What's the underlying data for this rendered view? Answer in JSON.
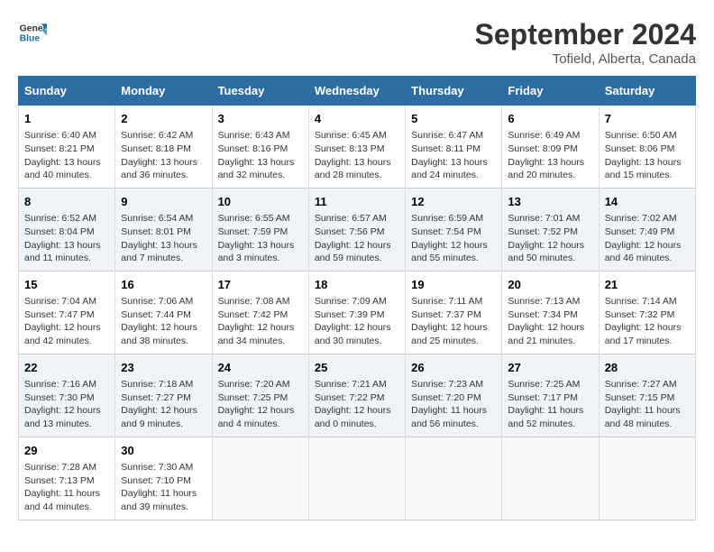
{
  "header": {
    "logo_line1": "General",
    "logo_line2": "Blue",
    "month": "September 2024",
    "location": "Tofield, Alberta, Canada"
  },
  "weekdays": [
    "Sunday",
    "Monday",
    "Tuesday",
    "Wednesday",
    "Thursday",
    "Friday",
    "Saturday"
  ],
  "weeks": [
    [
      {
        "day": "1",
        "info": "Sunrise: 6:40 AM\nSunset: 8:21 PM\nDaylight: 13 hours\nand 40 minutes."
      },
      {
        "day": "2",
        "info": "Sunrise: 6:42 AM\nSunset: 8:18 PM\nDaylight: 13 hours\nand 36 minutes."
      },
      {
        "day": "3",
        "info": "Sunrise: 6:43 AM\nSunset: 8:16 PM\nDaylight: 13 hours\nand 32 minutes."
      },
      {
        "day": "4",
        "info": "Sunrise: 6:45 AM\nSunset: 8:13 PM\nDaylight: 13 hours\nand 28 minutes."
      },
      {
        "day": "5",
        "info": "Sunrise: 6:47 AM\nSunset: 8:11 PM\nDaylight: 13 hours\nand 24 minutes."
      },
      {
        "day": "6",
        "info": "Sunrise: 6:49 AM\nSunset: 8:09 PM\nDaylight: 13 hours\nand 20 minutes."
      },
      {
        "day": "7",
        "info": "Sunrise: 6:50 AM\nSunset: 8:06 PM\nDaylight: 13 hours\nand 15 minutes."
      }
    ],
    [
      {
        "day": "8",
        "info": "Sunrise: 6:52 AM\nSunset: 8:04 PM\nDaylight: 13 hours\nand 11 minutes."
      },
      {
        "day": "9",
        "info": "Sunrise: 6:54 AM\nSunset: 8:01 PM\nDaylight: 13 hours\nand 7 minutes."
      },
      {
        "day": "10",
        "info": "Sunrise: 6:55 AM\nSunset: 7:59 PM\nDaylight: 13 hours\nand 3 minutes."
      },
      {
        "day": "11",
        "info": "Sunrise: 6:57 AM\nSunset: 7:56 PM\nDaylight: 12 hours\nand 59 minutes."
      },
      {
        "day": "12",
        "info": "Sunrise: 6:59 AM\nSunset: 7:54 PM\nDaylight: 12 hours\nand 55 minutes."
      },
      {
        "day": "13",
        "info": "Sunrise: 7:01 AM\nSunset: 7:52 PM\nDaylight: 12 hours\nand 50 minutes."
      },
      {
        "day": "14",
        "info": "Sunrise: 7:02 AM\nSunset: 7:49 PM\nDaylight: 12 hours\nand 46 minutes."
      }
    ],
    [
      {
        "day": "15",
        "info": "Sunrise: 7:04 AM\nSunset: 7:47 PM\nDaylight: 12 hours\nand 42 minutes."
      },
      {
        "day": "16",
        "info": "Sunrise: 7:06 AM\nSunset: 7:44 PM\nDaylight: 12 hours\nand 38 minutes."
      },
      {
        "day": "17",
        "info": "Sunrise: 7:08 AM\nSunset: 7:42 PM\nDaylight: 12 hours\nand 34 minutes."
      },
      {
        "day": "18",
        "info": "Sunrise: 7:09 AM\nSunset: 7:39 PM\nDaylight: 12 hours\nand 30 minutes."
      },
      {
        "day": "19",
        "info": "Sunrise: 7:11 AM\nSunset: 7:37 PM\nDaylight: 12 hours\nand 25 minutes."
      },
      {
        "day": "20",
        "info": "Sunrise: 7:13 AM\nSunset: 7:34 PM\nDaylight: 12 hours\nand 21 minutes."
      },
      {
        "day": "21",
        "info": "Sunrise: 7:14 AM\nSunset: 7:32 PM\nDaylight: 12 hours\nand 17 minutes."
      }
    ],
    [
      {
        "day": "22",
        "info": "Sunrise: 7:16 AM\nSunset: 7:30 PM\nDaylight: 12 hours\nand 13 minutes."
      },
      {
        "day": "23",
        "info": "Sunrise: 7:18 AM\nSunset: 7:27 PM\nDaylight: 12 hours\nand 9 minutes."
      },
      {
        "day": "24",
        "info": "Sunrise: 7:20 AM\nSunset: 7:25 PM\nDaylight: 12 hours\nand 4 minutes."
      },
      {
        "day": "25",
        "info": "Sunrise: 7:21 AM\nSunset: 7:22 PM\nDaylight: 12 hours\nand 0 minutes."
      },
      {
        "day": "26",
        "info": "Sunrise: 7:23 AM\nSunset: 7:20 PM\nDaylight: 11 hours\nand 56 minutes."
      },
      {
        "day": "27",
        "info": "Sunrise: 7:25 AM\nSunset: 7:17 PM\nDaylight: 11 hours\nand 52 minutes."
      },
      {
        "day": "28",
        "info": "Sunrise: 7:27 AM\nSunset: 7:15 PM\nDaylight: 11 hours\nand 48 minutes."
      }
    ],
    [
      {
        "day": "29",
        "info": "Sunrise: 7:28 AM\nSunset: 7:13 PM\nDaylight: 11 hours\nand 44 minutes."
      },
      {
        "day": "30",
        "info": "Sunrise: 7:30 AM\nSunset: 7:10 PM\nDaylight: 11 hours\nand 39 minutes."
      },
      {
        "day": "",
        "info": ""
      },
      {
        "day": "",
        "info": ""
      },
      {
        "day": "",
        "info": ""
      },
      {
        "day": "",
        "info": ""
      },
      {
        "day": "",
        "info": ""
      }
    ]
  ]
}
